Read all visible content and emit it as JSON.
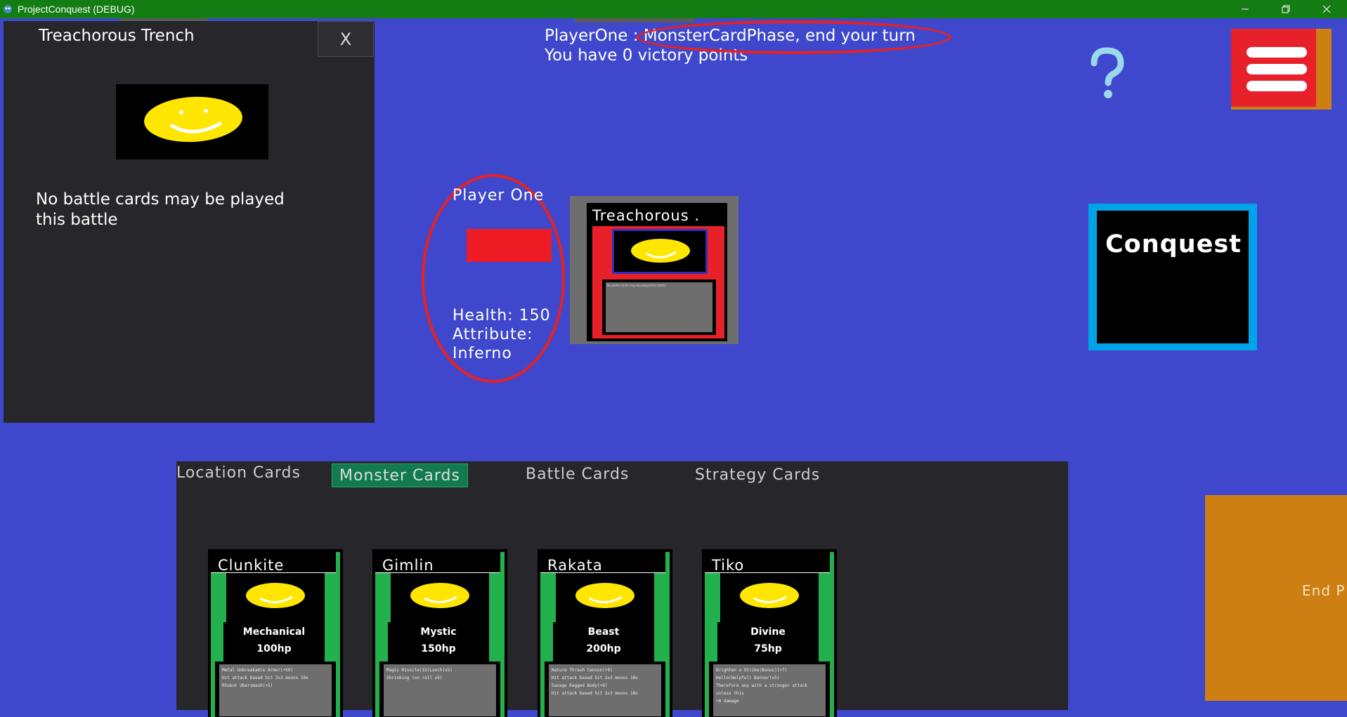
{
  "window": {
    "title": "ProjectConquest (DEBUG)",
    "icon": "godot-icon",
    "controls": [
      "minimize-icon",
      "restore-icon",
      "close-icon"
    ]
  },
  "detail_panel": {
    "title": "Treachorous Trench",
    "close_label": "X",
    "description": "No battle cards may be played this battle"
  },
  "header": {
    "phase_text": "PlayerOne : MonsterCardPhase, end your turn",
    "victory_text": "You have 0 victory points",
    "help_icon": "question-mark-icon",
    "menu_icon": "hamburger-menu-icon"
  },
  "player": {
    "name": "Player One",
    "color": "#ed1c24",
    "health_text": "Health: 150",
    "attribute_label": "Attribute:",
    "attribute_value": "Inferno"
  },
  "location_card": {
    "name": "Treachorous .",
    "text": "No battle cards may be played this battle"
  },
  "conquest_button": {
    "label": "Conquest"
  },
  "hand": {
    "tabs": [
      {
        "label": "Location Cards",
        "active": false
      },
      {
        "label": "Monster Cards",
        "active": true
      },
      {
        "label": "Battle Cards",
        "active": false
      },
      {
        "label": "Strategy Cards",
        "active": false
      }
    ],
    "cards": [
      {
        "name": "Clunkite",
        "attribute": "Mechanical",
        "hp": "100hp",
        "lines": [
          "Metal Unbreakable Armor(+50)",
          "Hit attack based hit 2x3 moons 10x",
          "Rhobot Ubersmash(+5)"
        ]
      },
      {
        "name": "Gimlin",
        "attribute": "Mystic",
        "hp": "150hp",
        "lines": [
          "Magic Missile(15)Lunch(x5)",
          "Shrinking (on roll x5)"
        ]
      },
      {
        "name": "Rakata",
        "attribute": "Beast",
        "hp": "200hp",
        "lines": [
          "Nature Thrash Cannon(+9)",
          "Hit attack based hit 2x3 moons 10x",
          "Savage Ragged Body(+8)",
          "Hit attack based hit 3x3 moons 10x"
        ]
      },
      {
        "name": "Tiko",
        "attribute": "Divine",
        "hp": "75hp",
        "lines": [
          "Brighten a Strike(Bonus)(+7)",
          "Hello(Helpful) Banner(x5)",
          "Therefore any with a stronger attack unless this",
          "+8 damage"
        ]
      }
    ]
  },
  "end_phase": {
    "label": "End P"
  },
  "colors": {
    "background": "#3f48cc",
    "titlebar": "#137c13",
    "panel": "#26262b",
    "card_green": "#22b14c",
    "accent_orange": "#cd7f12",
    "annotation_red": "#e82020",
    "conquest_border": "#00a2e8"
  }
}
